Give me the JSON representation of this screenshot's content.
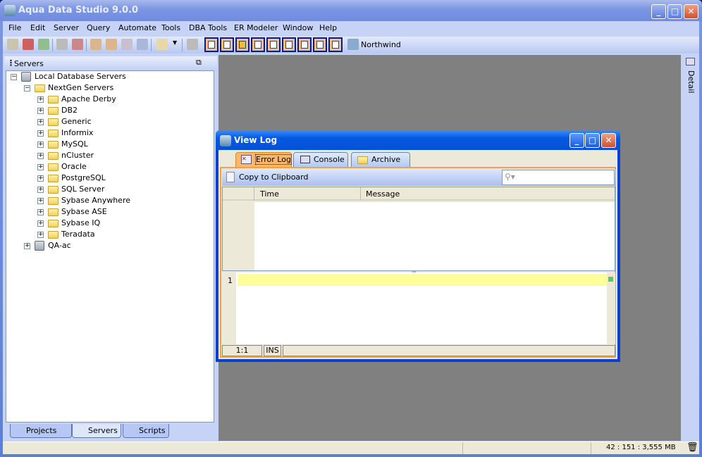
{
  "app": {
    "title": "Aqua Data Studio 9.0.0"
  },
  "menu": [
    "File",
    "Edit",
    "Server",
    "Query",
    "Automate",
    "Tools",
    "DBA Tools",
    "ER Modeler",
    "Window",
    "Help"
  ],
  "toolbar": {
    "connection": "Northwind"
  },
  "servers_panel": {
    "title": "Servers",
    "root": "Local Database Servers",
    "group": "NextGen Servers",
    "children": [
      "Apache Derby",
      "DB2",
      "Generic",
      "Informix",
      "MySQL",
      "nCluster",
      "Oracle",
      "PostgreSQL",
      "SQL Server",
      "Sybase Anywhere",
      "Sybase ASE",
      "Sybase IQ",
      "Teradata"
    ],
    "other": "QA-ac"
  },
  "bottom_tabs": [
    "Projects",
    "Servers",
    "Scripts"
  ],
  "right_strip": {
    "label": "Detail"
  },
  "status": {
    "memory": "42 : 151 : 3,555 MB"
  },
  "dialog": {
    "title": "View Log",
    "tabs": [
      "Error Log",
      "Console",
      "Archive"
    ],
    "copy_label": "Copy to Clipboard",
    "search_placeholder": "",
    "columns": [
      "Time",
      "Message"
    ],
    "line_number": "1",
    "pos": "1:1",
    "mode": "INS"
  }
}
